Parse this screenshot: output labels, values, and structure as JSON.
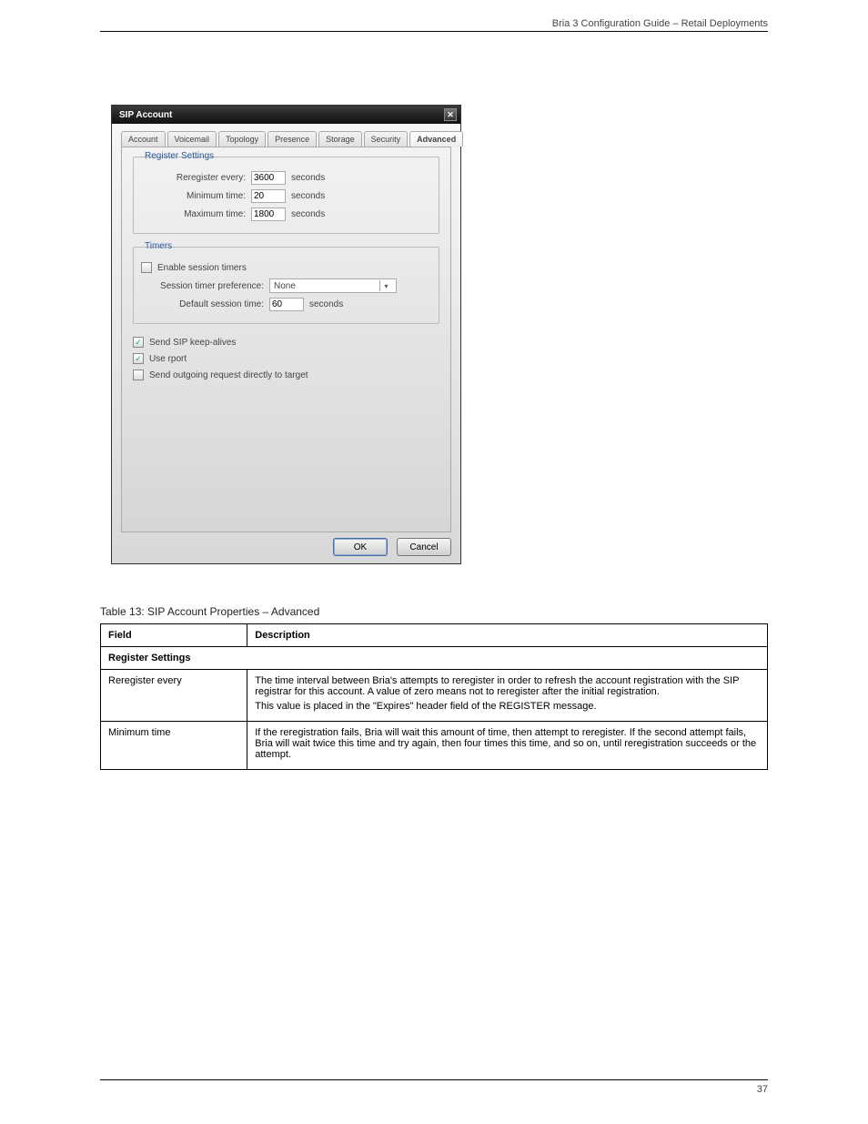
{
  "page": {
    "header_text": "Bria 3 Configuration Guide – Retail Deployments",
    "footer_text": "37"
  },
  "dialog": {
    "title": "SIP Account",
    "close_icon": "✕",
    "tabs": [
      {
        "label": "Account"
      },
      {
        "label": "Voicemail"
      },
      {
        "label": "Topology"
      },
      {
        "label": "Presence"
      },
      {
        "label": "Storage"
      },
      {
        "label": "Security"
      },
      {
        "label": "Advanced",
        "active": true
      }
    ],
    "register_group": {
      "legend": "Register Settings",
      "rows": [
        {
          "label": "Reregister every:",
          "value": "3600",
          "unit": "seconds"
        },
        {
          "label": "Minimum time:",
          "value": "20",
          "unit": "seconds"
        },
        {
          "label": "Maximum time:",
          "value": "1800",
          "unit": "seconds"
        }
      ]
    },
    "timers_group": {
      "legend": "Timers",
      "enable_label": "Enable session timers",
      "pref_label": "Session timer preference:",
      "pref_value": "None",
      "default_label": "Default session time:",
      "default_value": "60",
      "default_unit": "seconds"
    },
    "checks": [
      {
        "label": "Send SIP keep-alives",
        "checked": true
      },
      {
        "label": "Use rport",
        "checked": true
      },
      {
        "label": "Send outgoing request directly to target",
        "checked": false
      }
    ],
    "buttons": {
      "ok": "OK",
      "cancel": "Cancel"
    }
  },
  "fields_table": {
    "title": "Table 13: SIP Account Properties – Advanced",
    "headers": {
      "field": "Field",
      "desc": "Description"
    },
    "section": "Register Settings",
    "rows": [
      {
        "field": "Reregister every",
        "desc": [
          "The time interval between Bria's attempts to reregister in order to refresh the account registration with the SIP registrar for this account. A value of zero means not to reregister after the initial registration.",
          "This value is placed in the \"Expires\" header field of the REGISTER message."
        ]
      },
      {
        "field": "Minimum time",
        "desc": [
          "If the reregistration fails, Bria will wait this amount of time, then attempt to reregister. If the second attempt fails, Bria will wait twice this time and try again, then four times this time, and so on, until reregistration succeeds or the attempt."
        ]
      }
    ]
  }
}
